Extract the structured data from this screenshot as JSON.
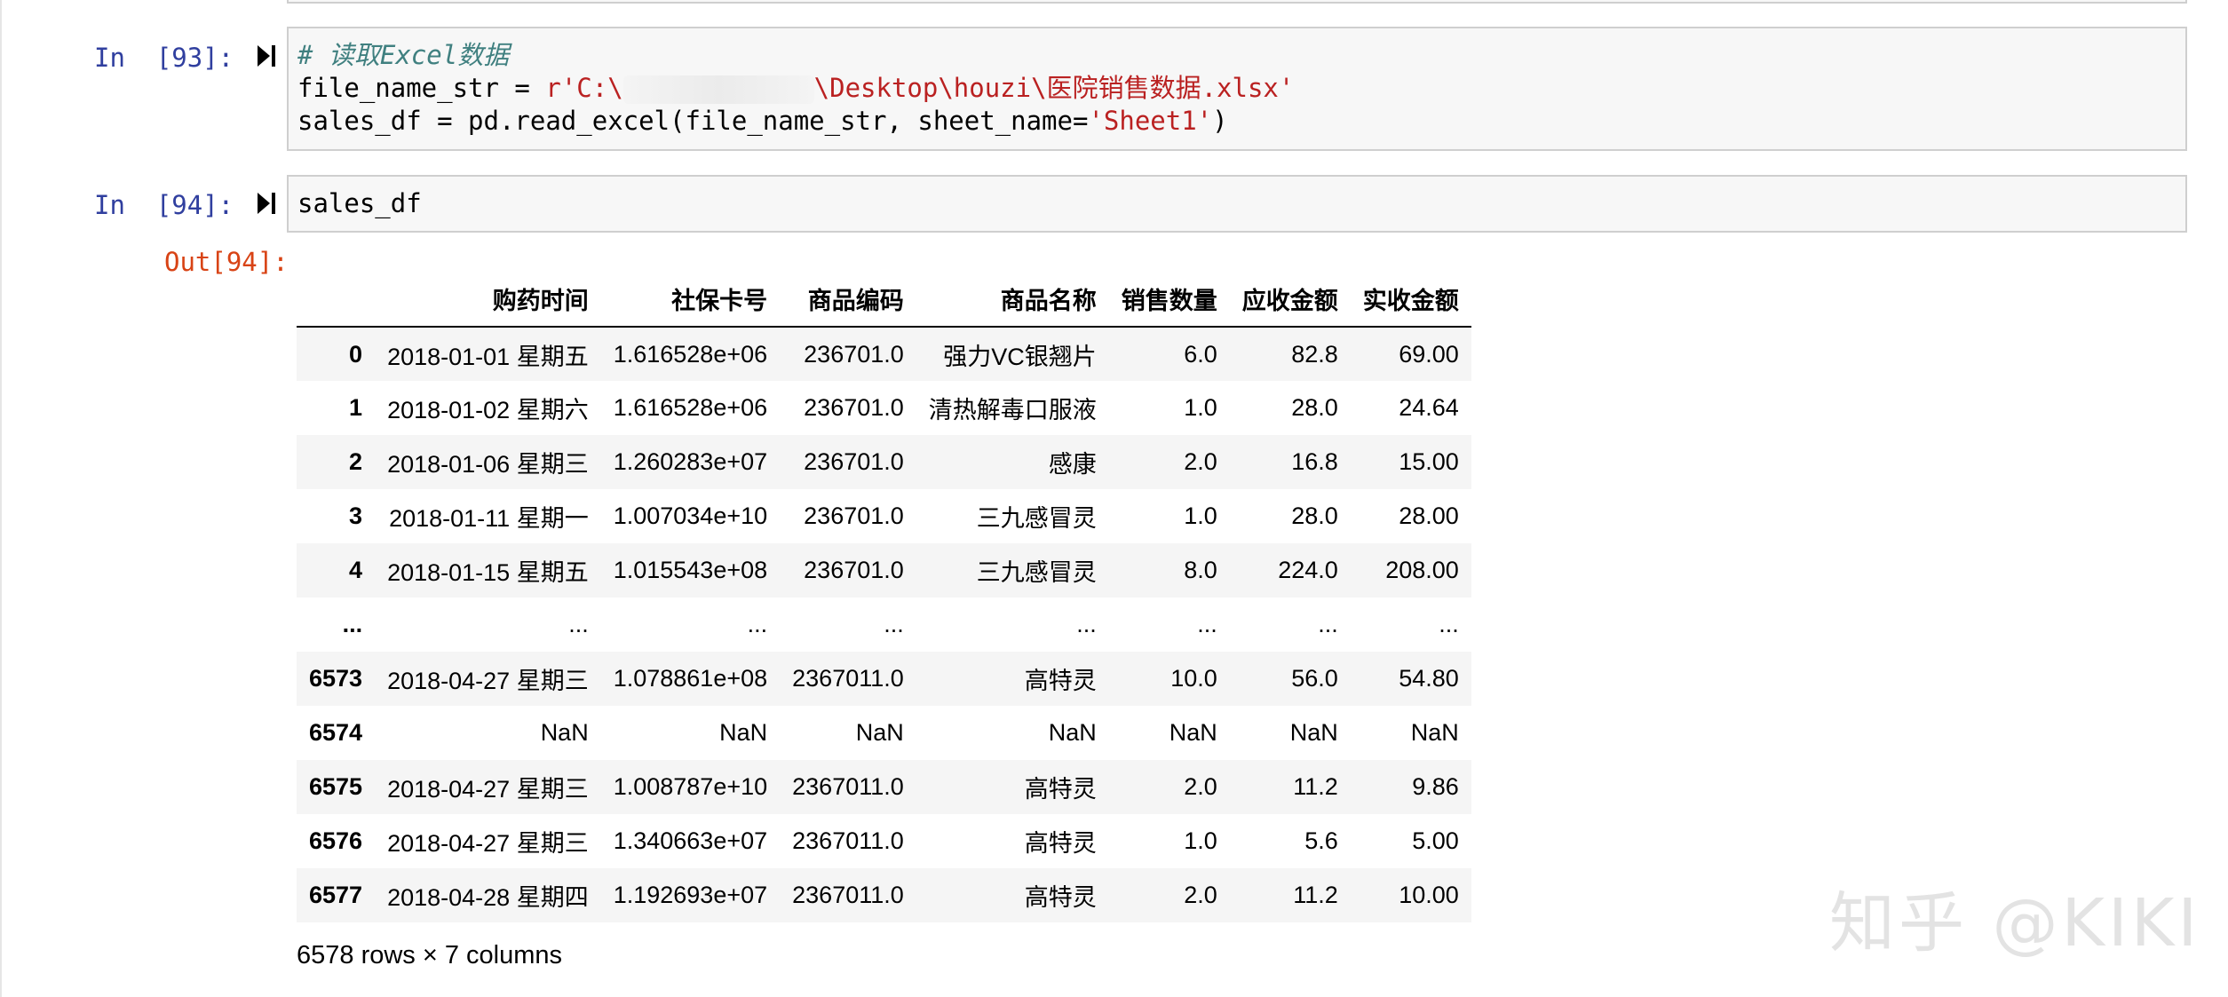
{
  "cells": {
    "c93": {
      "prompt": "In  [93]:",
      "comment": "# 读取Excel数据",
      "line2_a": "file_name_str = ",
      "line2_str_a": "r'C:\\",
      "line2_str_b": "\\Desktop\\houzi\\医院销售数据.xlsx'",
      "line3_a": "sales_df = pd.read_excel(file_name_str, sheet_name=",
      "line3_str": "'Sheet1'",
      "line3_b": ")"
    },
    "c94": {
      "prompt": "In  [94]:",
      "code": "sales_df",
      "out_prompt": "Out[94]:"
    }
  },
  "table": {
    "columns": [
      "购药时间",
      "社保卡号",
      "商品编码",
      "商品名称",
      "销售数量",
      "应收金额",
      "实收金额"
    ],
    "rows": [
      {
        "idx": "0",
        "cells": [
          "2018-01-01 星期五",
          "1.616528e+06",
          "236701.0",
          "强力VC银翘片",
          "6.0",
          "82.8",
          "69.00"
        ]
      },
      {
        "idx": "1",
        "cells": [
          "2018-01-02 星期六",
          "1.616528e+06",
          "236701.0",
          "清热解毒口服液",
          "1.0",
          "28.0",
          "24.64"
        ]
      },
      {
        "idx": "2",
        "cells": [
          "2018-01-06 星期三",
          "1.260283e+07",
          "236701.0",
          "感康",
          "2.0",
          "16.8",
          "15.00"
        ]
      },
      {
        "idx": "3",
        "cells": [
          "2018-01-11 星期一",
          "1.007034e+10",
          "236701.0",
          "三九感冒灵",
          "1.0",
          "28.0",
          "28.00"
        ]
      },
      {
        "idx": "4",
        "cells": [
          "2018-01-15 星期五",
          "1.015543e+08",
          "236701.0",
          "三九感冒灵",
          "8.0",
          "224.0",
          "208.00"
        ]
      },
      {
        "idx": "...",
        "cells": [
          "...",
          "...",
          "...",
          "...",
          "...",
          "...",
          "..."
        ]
      },
      {
        "idx": "6573",
        "cells": [
          "2018-04-27 星期三",
          "1.078861e+08",
          "2367011.0",
          "高特灵",
          "10.0",
          "56.0",
          "54.80"
        ]
      },
      {
        "idx": "6574",
        "cells": [
          "NaN",
          "NaN",
          "NaN",
          "NaN",
          "NaN",
          "NaN",
          "NaN"
        ]
      },
      {
        "idx": "6575",
        "cells": [
          "2018-04-27 星期三",
          "1.008787e+10",
          "2367011.0",
          "高特灵",
          "2.0",
          "11.2",
          "9.86"
        ]
      },
      {
        "idx": "6576",
        "cells": [
          "2018-04-27 星期三",
          "1.340663e+07",
          "2367011.0",
          "高特灵",
          "1.0",
          "5.6",
          "5.00"
        ]
      },
      {
        "idx": "6577",
        "cells": [
          "2018-04-28 星期四",
          "1.192693e+07",
          "2367011.0",
          "高特灵",
          "2.0",
          "11.2",
          "10.00"
        ]
      }
    ],
    "summary": "6578 rows × 7 columns"
  },
  "watermark": "知乎 @KIKI",
  "colors": {
    "prompt_in": "#303f9f",
    "prompt_out": "#d84315",
    "string": "#ba2121",
    "comment": "#408080"
  }
}
